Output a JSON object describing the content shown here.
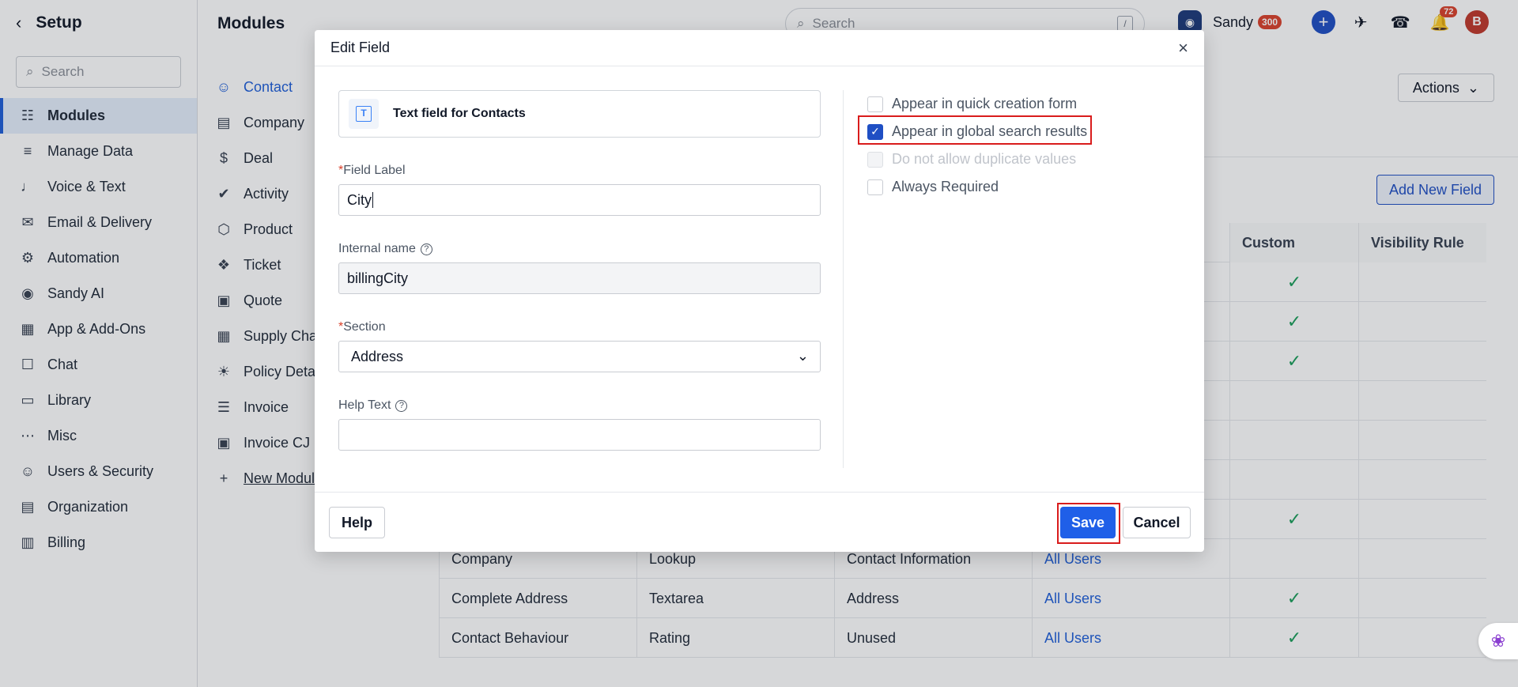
{
  "sidebar": {
    "title": "Setup",
    "search_placeholder": "Search",
    "items": [
      {
        "label": "Modules",
        "icon": "modules-icon",
        "active": true
      },
      {
        "label": "Manage Data",
        "icon": "database-icon"
      },
      {
        "label": "Voice & Text",
        "icon": "microphone-icon"
      },
      {
        "label": "Email & Delivery",
        "icon": "envelope-icon"
      },
      {
        "label": "Automation",
        "icon": "automation-icon"
      },
      {
        "label": "Sandy AI",
        "icon": "robot-icon"
      },
      {
        "label": "App & Add-Ons",
        "icon": "grid-icon"
      },
      {
        "label": "Chat",
        "icon": "chat-icon"
      },
      {
        "label": "Library",
        "icon": "folder-icon"
      },
      {
        "label": "Misc",
        "icon": "ellipsis-icon"
      },
      {
        "label": "Users & Security",
        "icon": "user-icon"
      },
      {
        "label": "Organization",
        "icon": "building-icon"
      },
      {
        "label": "Billing",
        "icon": "billing-icon"
      }
    ]
  },
  "modules": {
    "title": "Modules",
    "items": [
      {
        "label": "Contact",
        "icon": "person-icon"
      },
      {
        "label": "Company",
        "icon": "building-icon"
      },
      {
        "label": "Deal",
        "icon": "dollar-icon"
      },
      {
        "label": "Activity",
        "icon": "check-circle-icon"
      },
      {
        "label": "Product",
        "icon": "box-icon"
      },
      {
        "label": "Ticket",
        "icon": "tag-icon"
      },
      {
        "label": "Quote",
        "icon": "quote-icon"
      },
      {
        "label": "Supply Cha",
        "icon": "supply-icon"
      },
      {
        "label": "Policy Detai",
        "icon": "policy-icon"
      },
      {
        "label": "Invoice",
        "icon": "list-icon"
      },
      {
        "label": "Invoice CJ",
        "icon": "invoice-icon"
      },
      {
        "label": "New Modul",
        "icon": "plus-icon"
      }
    ]
  },
  "topbar": {
    "search_placeholder": "Search",
    "shortcut": "/",
    "user_name": "Sandy",
    "user_badge": "300",
    "notification_count": "72",
    "avatar_initial": "B"
  },
  "content": {
    "actions_label": "Actions",
    "add_field_label": "Add New Field",
    "columns": {
      "custom": "Custom",
      "visibility": "Visibility Rule"
    },
    "rows": [
      {
        "name": "",
        "type": "",
        "section": "",
        "visibility": "",
        "custom": true
      },
      {
        "name": "",
        "type": "",
        "section": "",
        "visibility": "",
        "custom": true
      },
      {
        "name": "",
        "type": "",
        "section": "",
        "visibility": "",
        "custom": true
      },
      {
        "name": "",
        "type": "",
        "section": "",
        "visibility": "",
        "custom": false
      },
      {
        "name": "",
        "type": "",
        "section": "",
        "visibility": "",
        "custom": false
      },
      {
        "name": "",
        "type": "",
        "section": "",
        "visibility": "",
        "custom": false
      },
      {
        "name": "",
        "type": "",
        "section": "",
        "visibility": "",
        "custom": true
      },
      {
        "name": "Company",
        "type": "Lookup",
        "section": "Contact Information",
        "visibility": "All Users",
        "custom": false
      },
      {
        "name": "Complete Address",
        "type": "Textarea",
        "section": "Address",
        "visibility": "All Users",
        "custom": true
      },
      {
        "name": "Contact Behaviour",
        "type": "Rating",
        "section": "Unused",
        "visibility": "All Users",
        "custom": true
      }
    ]
  },
  "dialog": {
    "title": "Edit Field",
    "field_type": "Text field for Contacts",
    "field_label_label": "Field Label",
    "field_label_value": "City",
    "internal_name_label": "Internal name",
    "internal_name_value": "billingCity",
    "section_label": "Section",
    "section_value": "Address",
    "help_text_label": "Help Text",
    "help_text_value": "",
    "required_mark": "*",
    "options": [
      {
        "label": "Appear in quick creation form",
        "checked": false,
        "disabled": false
      },
      {
        "label": "Appear in global search results",
        "checked": true,
        "disabled": false
      },
      {
        "label": "Do not allow duplicate values",
        "checked": false,
        "disabled": true
      },
      {
        "label": "Always Required",
        "checked": false,
        "disabled": false
      }
    ],
    "help_button": "Help",
    "save_button": "Save",
    "cancel_button": "Cancel"
  },
  "colors": {
    "accent": "#1f5fe8",
    "highlight": "#d91c1c",
    "check": "#1a9e5a"
  }
}
